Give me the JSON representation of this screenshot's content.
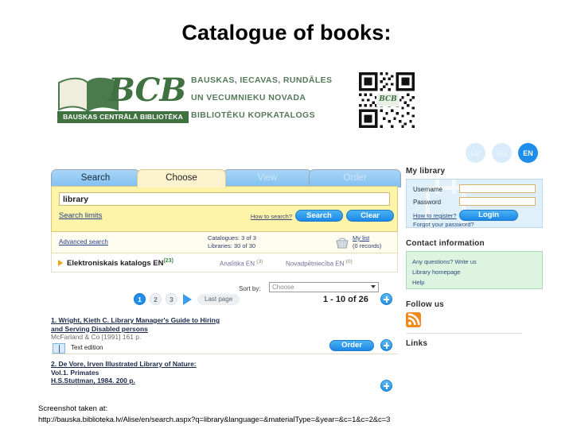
{
  "title": "Catalogue of books:",
  "logo": {
    "acronym": "BCB",
    "band": "BAUSKAS CENTRĀLĀ BIBLIOTĒKA",
    "lines": [
      "BAUSKAS, IECAVAS, RUNDĀLES",
      "UN VECUMNIEKU NOVADA",
      "BIBLIOTĒKU KOPKATALOGS"
    ],
    "qr_inner_label": "BCB"
  },
  "languages": [
    {
      "code": "LV",
      "active": false
    },
    {
      "code": "RU",
      "active": false
    },
    {
      "code": "EN",
      "active": true
    }
  ],
  "tabs": [
    {
      "label": "Search",
      "state": "lit"
    },
    {
      "label": "Choose",
      "state": "active"
    },
    {
      "label": "View",
      "state": "dim"
    },
    {
      "label": "Order",
      "state": "dim"
    }
  ],
  "search": {
    "query": "library",
    "limits_link": "Search limits",
    "how_to_link": "How to search?",
    "search_button": "Search",
    "clear_button": "Clear",
    "advanced_link": "Advanced search",
    "catalogues_count": "Catalogues: 3 of 3",
    "libraries_count": "Libraries: 30 of 30",
    "my_list_label": "My list",
    "my_list_count": "(0 records)"
  },
  "catalogs": [
    {
      "label": "Elektroniskais katalogs EN",
      "count": "(23)"
    },
    {
      "label": "Analītika EN",
      "count": "(3)"
    },
    {
      "label": "Novadpētniecība EN",
      "count": "(0)"
    }
  ],
  "results": {
    "pages": [
      "1",
      "2",
      "3"
    ],
    "active_page": "1",
    "last_page_label": "Last page",
    "sort_label": "Sort by:",
    "sort_value": "Choose",
    "range": "1 - 10 of 26",
    "records": [
      {
        "line1": "1. Wright, Kieth C. Library Manager's Guide to Hiring",
        "line2": "and Serving Disabled persons",
        "line3": "McFarland & Co [1991] 161 p.",
        "format": "Text edition",
        "order_button": "Order"
      },
      {
        "line1": "2. De Vore, Irven Illustrated Library of Nature:",
        "line2": "Vol.1. Primates",
        "line3": "H.S.Stuttman, 1984. 200 p.",
        "format": "",
        "order_button": ""
      }
    ]
  },
  "my_library": {
    "heading": "My library",
    "username_label": "Username",
    "password_label": "Password",
    "username_value": "",
    "password_value": "",
    "register_link": "How to register?",
    "forgot_link": "Forgot your password?",
    "login_button": "Login"
  },
  "contact": {
    "heading": "Contact information",
    "links": [
      "Any questions? Write us",
      "Library homepage",
      "Help"
    ]
  },
  "follow": {
    "heading": "Follow us"
  },
  "links": {
    "heading": "Links"
  },
  "footer": {
    "caption": "Screenshot taken at:",
    "url": "http://bauska.biblioteka.lv/Alise/en/search.aspx?q=library&language=&materialType=&year=&c=1&c=2&c=3"
  }
}
